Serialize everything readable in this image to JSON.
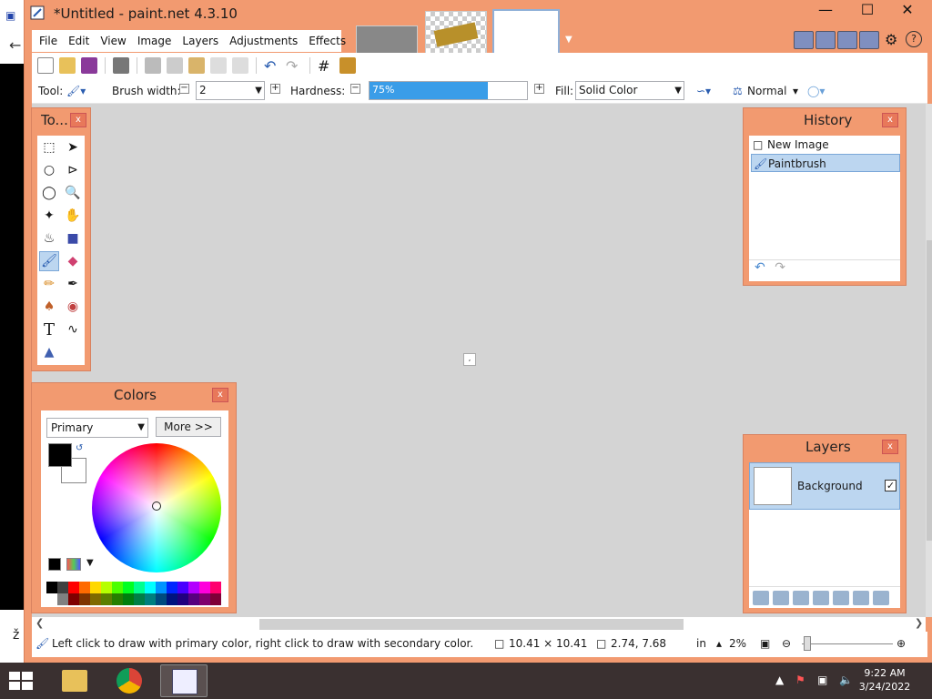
{
  "window": {
    "title": "*Untitled - paint.net 4.3.10",
    "controls": {
      "minimize": "—",
      "maximize": "☐",
      "close": "✕"
    }
  },
  "menu": [
    "File",
    "Edit",
    "View",
    "Image",
    "Layers",
    "Adjustments",
    "Effects"
  ],
  "toolbar": {
    "tool_label": "Tool:",
    "brush_width_label": "Brush width:",
    "brush_width_value": "2",
    "hardness_label": "Hardness:",
    "hardness_value": "75%",
    "hardness_fraction": 0.75,
    "fill_label": "Fill:",
    "fill_value": "Solid Color",
    "blend_mode": "Normal"
  },
  "panels": {
    "tools": {
      "title": "To...",
      "close": "x"
    },
    "colors": {
      "title": "Colors",
      "close": "x",
      "palette_select": "Primary",
      "more_button": "More >>",
      "primary_color": "#000000",
      "secondary_color": "#ffffff"
    },
    "history": {
      "title": "History",
      "close": "x",
      "items": [
        "New Image",
        "Paintbrush"
      ]
    },
    "layers": {
      "title": "Layers",
      "close": "x",
      "layer_name": "Background"
    }
  },
  "statusbar": {
    "hint": "Left click to draw with primary color, right click to draw with secondary color.",
    "selection_size": "10.41 × 10.41",
    "cursor_pos": "2.74, 7.68",
    "units": "in",
    "zoom": "2%"
  },
  "taskbar": {
    "time": "9:22 AM",
    "date": "3/24/2022"
  },
  "colors": {
    "accent": "#f29a70",
    "selection": "#bcd6f0",
    "hardness_fill": "#3a9de8"
  },
  "palette": [
    "#000000",
    "#404040",
    "#ff0000",
    "#ff6a00",
    "#ffd800",
    "#b6ff00",
    "#4cff00",
    "#00ff21",
    "#00ff90",
    "#00ffff",
    "#0094ff",
    "#0026ff",
    "#4800ff",
    "#b200ff",
    "#ff00dc",
    "#ff006e",
    "#ffffff",
    "#808080",
    "#7f0000",
    "#7f3300",
    "#7f6a00",
    "#5b7f00",
    "#267f00",
    "#007f0e",
    "#007f46",
    "#007f7f",
    "#004a7f",
    "#00137f",
    "#21007f",
    "#57007f",
    "#7f006e",
    "#7f0037"
  ]
}
